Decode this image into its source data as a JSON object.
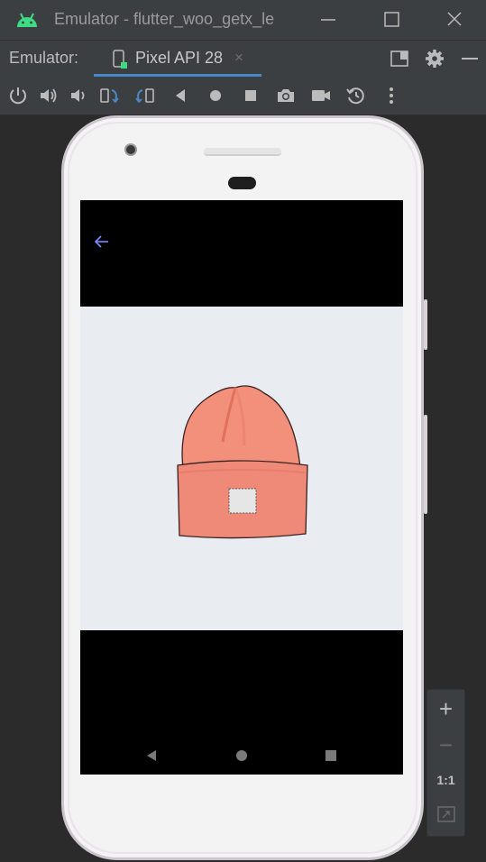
{
  "window": {
    "title": "Emulator - flutter_woo_getx_le",
    "icons": [
      "android-icon",
      "minimize-icon",
      "maximize-icon",
      "close-icon"
    ]
  },
  "tabbar": {
    "label": "Emulator:",
    "tab_label": "Pixel API 28",
    "tab_close": "×"
  },
  "toolbar": {
    "icons": [
      "power-icon",
      "volume-up-icon",
      "volume-down-icon",
      "rotate-left-icon",
      "rotate-right-icon",
      "back-icon",
      "home-icon",
      "overview-icon",
      "screenshot-icon",
      "record-icon",
      "snapshot-icon",
      "more-icon"
    ]
  },
  "app": {
    "back_icon": "arrow-back-icon",
    "image": "knit-beanie-hat"
  },
  "zoom": {
    "plus": "+",
    "minus": "−",
    "one_to_one": "1:1"
  },
  "colors": {
    "chrome": "#3c3f41",
    "background": "#2b2b2b",
    "accent": "#4a88c7",
    "android_green": "#3ddc84",
    "content_bg": "#e9edf2",
    "hat": "#f08a78"
  }
}
